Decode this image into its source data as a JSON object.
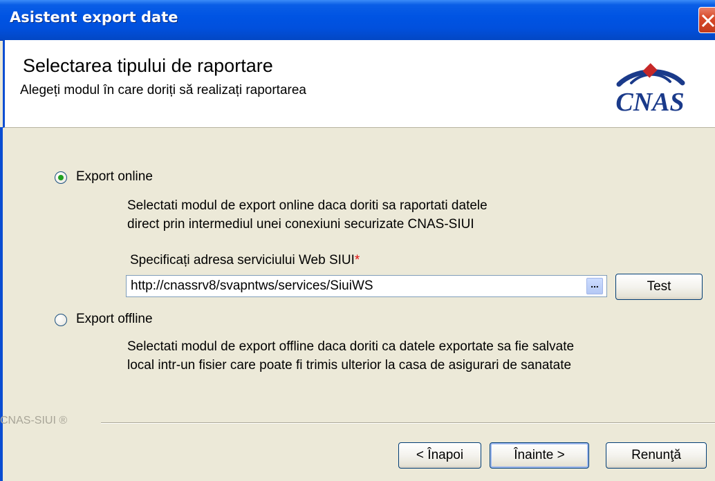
{
  "window": {
    "title": "Asistent export date"
  },
  "header": {
    "title": "Selectarea tipului de raportare",
    "subtitle": "Alegeți modul în care doriți să realizați raportarea",
    "logo_text": "CNAS"
  },
  "online": {
    "label": "Export online",
    "selected": true,
    "desc_line1": "Selectati modul de export online daca doriti sa raportati datele",
    "desc_line2": "direct prin intermediul unei conexiuni securizate CNAS-SIUI"
  },
  "service": {
    "label": "Specificați adresa serviciului Web SIUI",
    "required_marker": "*",
    "url": "http://cnassrv8/svapntws/services/SiuiWS",
    "browse_label": "...",
    "test_label": "Test"
  },
  "offline": {
    "label": "Export offline",
    "selected": false,
    "desc_line1": "Selectati modul de export offline daca doriti ca datele exportate sa fie salvate",
    "desc_line2": "local intr-un fisier care poate fi trimis ulterior la casa de asigurari de sanatate"
  },
  "footer": {
    "brand": "CNAS-SIUI ®",
    "back_label": "< Înapoi",
    "next_label": "Înainte >",
    "cancel_label": "Renunţă"
  },
  "colors": {
    "titlebar": "#0054e3",
    "dialog_bg": "#ece9d8",
    "required": "#e01010",
    "logo_blue": "#1a3a8a",
    "logo_red": "#c62828"
  }
}
